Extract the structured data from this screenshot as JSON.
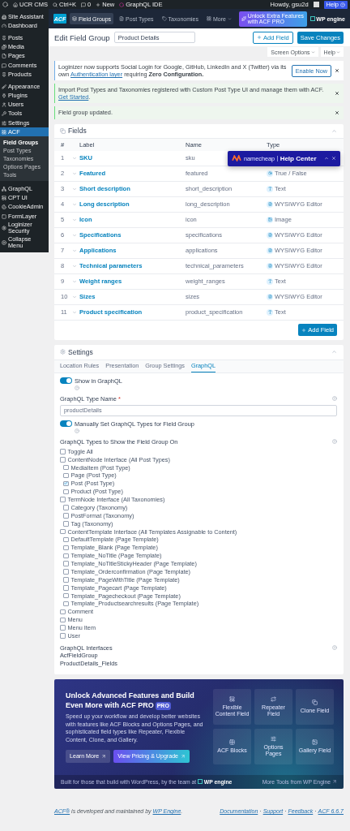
{
  "admin_bar": {
    "site": "UCR CMS",
    "search": "Ctrl+K",
    "comments": "0",
    "new": "New",
    "graphql": "GraphQL IDE",
    "greeting": "Howdy, gsu2d",
    "help": "Help"
  },
  "sidebar": {
    "groups": [
      {
        "items": [
          {
            "label": "Site Assistant",
            "selected": false
          },
          {
            "label": "Dashboard",
            "selected": false
          }
        ]
      },
      {
        "items": [
          {
            "label": "Posts",
            "selected": false
          },
          {
            "label": "Media",
            "selected": false
          },
          {
            "label": "Pages",
            "selected": false
          },
          {
            "label": "Comments",
            "selected": false
          },
          {
            "label": "Products",
            "selected": false
          }
        ]
      },
      {
        "items": [
          {
            "label": "Appearance",
            "selected": false
          },
          {
            "label": "Plugins",
            "selected": false
          },
          {
            "label": "Users",
            "selected": false
          },
          {
            "label": "Tools",
            "selected": false
          },
          {
            "label": "Settings",
            "selected": false
          },
          {
            "label": "ACF",
            "selected": true,
            "children": [
              {
                "label": "Field Groups",
                "selected": true
              },
              {
                "label": "Post Types",
                "selected": false
              },
              {
                "label": "Taxonomies",
                "selected": false
              },
              {
                "label": "Options Pages",
                "selected": false
              },
              {
                "label": "Tools",
                "selected": false
              }
            ]
          }
        ]
      },
      {
        "items": [
          {
            "label": "GraphQL",
            "selected": false
          },
          {
            "label": "CPT UI",
            "selected": false
          },
          {
            "label": "CookieAdmin",
            "selected": false
          },
          {
            "label": "FormLayer",
            "selected": false
          },
          {
            "label": "Loginizer Security",
            "selected": false
          },
          {
            "label": "Collapse Menu",
            "selected": false
          }
        ]
      }
    ]
  },
  "acf_nav": {
    "logo": "ACF",
    "tabs": [
      {
        "label": "Field Groups",
        "selected": true
      },
      {
        "label": "Post Types",
        "selected": false
      },
      {
        "label": "Taxonomies",
        "selected": false
      },
      {
        "label": "More",
        "selected": false
      }
    ],
    "upgrade": "Unlock Extra Features with ACF PRO",
    "brand": "WP engine"
  },
  "header": {
    "title": "Edit Field Group",
    "name_value": "Product Details",
    "add_field": "Add Field",
    "save": "Save Changes"
  },
  "screen_buttons": [
    "Screen Options",
    "Help"
  ],
  "notices": [
    {
      "kind": "info",
      "text": "Loginizer now supports Social Login for Google, GitHub, LinkedIn and X (Twitter) via its own ",
      "link": "Authentication layer",
      "text_after": " requiring **Zero Configuration.**",
      "button": "Enable Now"
    },
    {
      "kind": "success",
      "text": "Import Post Types and Taxonomies registered with Custom Post Type UI and manage them with ACF. ",
      "link": "Get Started",
      "text_after": "."
    },
    {
      "kind": "success",
      "text": "Field group updated."
    }
  ],
  "fields_panel": {
    "title": "Fields",
    "columns": [
      "#",
      "Label",
      "Name",
      "Type"
    ],
    "rows": [
      {
        "number": "1",
        "label": "SKU",
        "name": "sku"
      },
      {
        "number": "2",
        "label": "Featured",
        "name": "featured",
        "kind": "true_false",
        "type": "True / False"
      },
      {
        "number": "3",
        "label": "Short description",
        "name": "short_description",
        "kind": "text",
        "type": "Text"
      },
      {
        "number": "4",
        "label": "Long description",
        "name": "long_description",
        "kind": "wysiwyg",
        "type": "WYSIWYG Editor"
      },
      {
        "number": "5",
        "label": "Icon",
        "name": "icon",
        "kind": "image",
        "type": "Image"
      },
      {
        "number": "6",
        "label": "Specifications",
        "name": "specifications",
        "kind": "wysiwyg",
        "type": "WYSIWYG Editor"
      },
      {
        "number": "7",
        "label": "Applications",
        "name": "applications",
        "kind": "wysiwyg",
        "type": "WYSIWYG Editor"
      },
      {
        "number": "8",
        "label": "Technical parameters",
        "name": "technical_parameters",
        "kind": "wysiwyg",
        "type": "WYSIWYG Editor"
      },
      {
        "number": "9",
        "label": "Weight ranges",
        "name": "weight_ranges",
        "kind": "text",
        "type": "Text"
      },
      {
        "number": "10",
        "label": "Sizes",
        "name": "sizes",
        "kind": "wysiwyg",
        "type": "WYSIWYG Editor"
      },
      {
        "number": "11",
        "label": "Product specification",
        "name": "product_specification",
        "kind": "text",
        "type": "Text"
      }
    ],
    "add_button": "Add Field"
  },
  "help_center": {
    "brand": "namecheap",
    "title": "Help Center"
  },
  "settings": {
    "title": "Settings",
    "tabs": [
      {
        "label": "Location Rules",
        "selected": false
      },
      {
        "label": "Presentation",
        "selected": false
      },
      {
        "label": "Group Settings",
        "selected": false
      },
      {
        "label": "GraphQL",
        "selected": true
      }
    ],
    "show_in_graphql": {
      "label": "Show in GraphQL",
      "on": true
    },
    "type_name": {
      "label": "GraphQL Type Name",
      "required_mark": "*",
      "value": "productDetails"
    },
    "manual_types": {
      "label": "Manually Set GraphQL Types for Field Group",
      "on": true
    },
    "types_label": "GraphQL Types to Show the Field Group On",
    "types": [
      {
        "label": "Toggle All",
        "checked": false
      },
      {
        "label": "ContentNode Interface (All Post Types)",
        "checked": false,
        "children": [
          {
            "label": "MediaItem (Post Type)",
            "checked": false
          },
          {
            "label": "Page (Post Type)",
            "checked": false
          },
          {
            "label": "Post (Post Type)",
            "checked": true
          },
          {
            "label": "Product (Post Type)",
            "checked": false
          }
        ]
      },
      {
        "label": "TermNode Interface (All Taxonomies)",
        "checked": false,
        "children": [
          {
            "label": "Category (Taxonomy)",
            "checked": false
          },
          {
            "label": "PostFormat (Taxonomy)",
            "checked": false
          },
          {
            "label": "Tag (Taxonomy)",
            "checked": false
          }
        ]
      },
      {
        "label": "ContentTemplate Interface (All Templates Assignable to Content)",
        "checked": false,
        "children": [
          {
            "label": "DefaultTemplate (Page Template)",
            "checked": false
          },
          {
            "label": "Template_Blank (Page Template)",
            "checked": false
          },
          {
            "label": "Template_NoTitle (Page Template)",
            "checked": false
          },
          {
            "label": "Template_NoTitleStickyHeader (Page Template)",
            "checked": false
          },
          {
            "label": "Template_Orderconfirmation (Page Template)",
            "checked": false
          },
          {
            "label": "Template_PageWithTitle (Page Template)",
            "checked": false
          },
          {
            "label": "Template_Pagecart (Page Template)",
            "checked": false
          },
          {
            "label": "Template_Pagecheckout (Page Template)",
            "checked": false
          },
          {
            "label": "Template_Productsearchresults (Page Template)",
            "checked": false
          }
        ]
      },
      {
        "label": "Comment",
        "checked": false
      },
      {
        "label": "Menu",
        "checked": false
      },
      {
        "label": "Menu Item",
        "checked": false
      },
      {
        "label": "User",
        "checked": false
      }
    ],
    "interfaces_label": "GraphQL Interfaces",
    "interfaces": [
      "AcfFieldGroup",
      "ProductDetails_Fields"
    ]
  },
  "promo": {
    "title": "Unlock Advanced Features and Build Even More with ACF PRO",
    "badge": "PRO",
    "description": "Speed up your workflow and develop better websites with features like ACF Blocks and Options Pages, and sophisticated field types like Repeater, Flexible Content, Clone, and Gallery.",
    "buttons": [
      "Learn More",
      "View Pricing & Upgrade"
    ],
    "features": [
      "Flexible Content Field",
      "Repeater Field",
      "Clone Field",
      "ACF Blocks",
      "Options Pages",
      "Gallery Field"
    ],
    "footer": "Built for those that build with WordPress, by the team at",
    "footer_brand": "WP engine",
    "more": "More Tools from WP Engine"
  },
  "footer": {
    "credit_link": "ACF®",
    "credit_text": " is developed and maintained by ",
    "credit_link2": "WP Engine",
    "credit_end": ".",
    "links": [
      "Documentation",
      "Support",
      "Feedback",
      "ACF 6.6.7"
    ],
    "separator": "·"
  }
}
